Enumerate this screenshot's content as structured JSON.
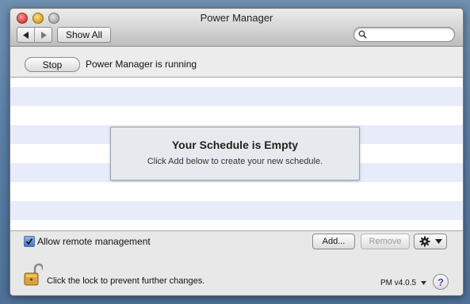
{
  "window": {
    "title": "Power Manager"
  },
  "toolbar": {
    "back_icon": "back-arrow-icon",
    "forward_icon": "forward-arrow-icon",
    "show_all_label": "Show All",
    "search": {
      "value": "",
      "placeholder": "",
      "icon": "search-icon"
    }
  },
  "status": {
    "stop_label": "Stop",
    "message": "Power Manager is running"
  },
  "schedule": {
    "empty_title": "Your Schedule is Empty",
    "empty_subtitle": "Click Add below to create your new schedule.",
    "row_colors": [
      "#ffffff",
      "#e8ecfa"
    ]
  },
  "footer": {
    "remote_checkbox": {
      "label": "Allow remote management",
      "checked": true
    },
    "add_label": "Add...",
    "remove_label": "Remove",
    "gear_icon": "gear-icon",
    "lock_icon": "lock-icon",
    "lock_message": "Click the lock to prevent further changes.",
    "version": "PM v4.0.5",
    "help_label": "?"
  },
  "colors": {
    "accent": "#3f76cc",
    "help_mark": "#6b3fb1"
  }
}
